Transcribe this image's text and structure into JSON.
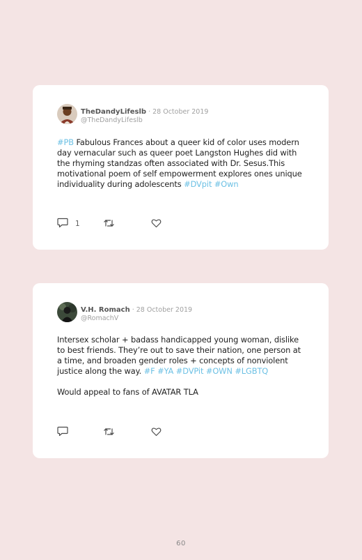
{
  "tweets": [
    {
      "name": "TheDandyLifeslb",
      "separator": " · ",
      "date": "28 October 2019",
      "handle": "@TheDandyLifeslb",
      "body_segments": [
        {
          "text": "#PB",
          "type": "hashtag"
        },
        {
          "text": " Fabulous Frances about a queer kid of color uses modern day vernacular such as queer poet Langston Hughes did with the rhyming standzas often associated with Dr. Sesus.This motivational poem of self empowerment explores ones unique individuality during adolescents ",
          "type": "text"
        },
        {
          "text": "#DVpit",
          "type": "hashtag"
        },
        {
          "text": " ",
          "type": "text"
        },
        {
          "text": "#Own",
          "type": "hashtag"
        }
      ],
      "reply_count": "1"
    },
    {
      "name": "V.H. Romach",
      "separator": " · ",
      "date": "28 October 2019",
      "handle": "@RomachV",
      "body_segments": [
        {
          "text": "Intersex scholar + badass handicapped young woman, dislike to best friends. They’re out to save their nation, one person at a time, and broaden gender roles + concepts of nonviolent justice along the way. ",
          "type": "text"
        },
        {
          "text": "#F",
          "type": "hashtag"
        },
        {
          "text": " ",
          "type": "text"
        },
        {
          "text": "#YA",
          "type": "hashtag"
        },
        {
          "text": " ",
          "type": "text"
        },
        {
          "text": "#DVPit",
          "type": "hashtag"
        },
        {
          "text": " ",
          "type": "text"
        },
        {
          "text": "#OWN",
          "type": "hashtag"
        },
        {
          "text": " ",
          "type": "text"
        },
        {
          "text": "#LGBTQ",
          "type": "hashtag"
        }
      ],
      "second_paragraph": "Would appeal to fans of AVATAR TLA",
      "reply_count": ""
    }
  ],
  "icons": {
    "reply": "reply-icon",
    "retweet": "retweet-icon",
    "like": "heart-icon"
  },
  "colors": {
    "background": "#f4e4e4",
    "card": "#ffffff",
    "hashtag": "#6cc0e4",
    "meta": "#a0a0a0",
    "name": "#555555"
  },
  "page_number": "60"
}
